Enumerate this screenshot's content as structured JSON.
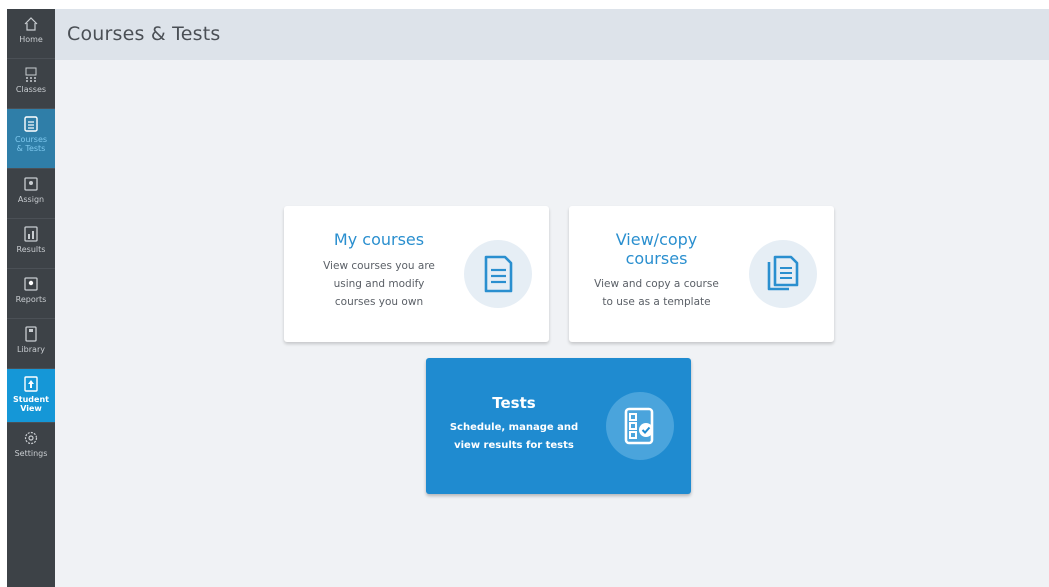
{
  "page": {
    "title": "Courses & Tests"
  },
  "sidebar": {
    "items": [
      {
        "label": "Home",
        "icon": "home-icon"
      },
      {
        "label": "Classes",
        "icon": "classes-icon"
      },
      {
        "label": "Courses & Tests",
        "icon": "courses-icon",
        "active": true
      },
      {
        "label": "Assign",
        "icon": "assign-icon"
      },
      {
        "label": "Results",
        "icon": "results-icon"
      },
      {
        "label": "Reports",
        "icon": "reports-icon"
      },
      {
        "label": "Library",
        "icon": "library-icon"
      },
      {
        "label": "Student View",
        "icon": "student-view-icon"
      },
      {
        "label": "Settings",
        "icon": "settings-icon"
      }
    ]
  },
  "cards": {
    "my_courses": {
      "title": "My courses",
      "desc_lines": [
        "View courses you are",
        "using and modify",
        "courses you own"
      ],
      "icon": "document-icon"
    },
    "view_copy": {
      "title_lines": [
        "View/copy",
        "courses"
      ],
      "desc_lines": [
        "View and copy a course",
        "to use as a template"
      ],
      "icon": "copy-document-icon"
    },
    "tests": {
      "title": "Tests",
      "desc_lines": [
        "Schedule, manage and",
        "view results for tests"
      ],
      "icon": "checklist-icon"
    }
  },
  "colors": {
    "sidebar_bg": "#3d4247",
    "sidebar_active": "#2f7ea8",
    "student_view": "#1597d7",
    "accent": "#2a8fcf",
    "tests_card": "#1f8bd0",
    "header_bg": "#dde3ea",
    "content_bg": "#f0f2f5"
  }
}
